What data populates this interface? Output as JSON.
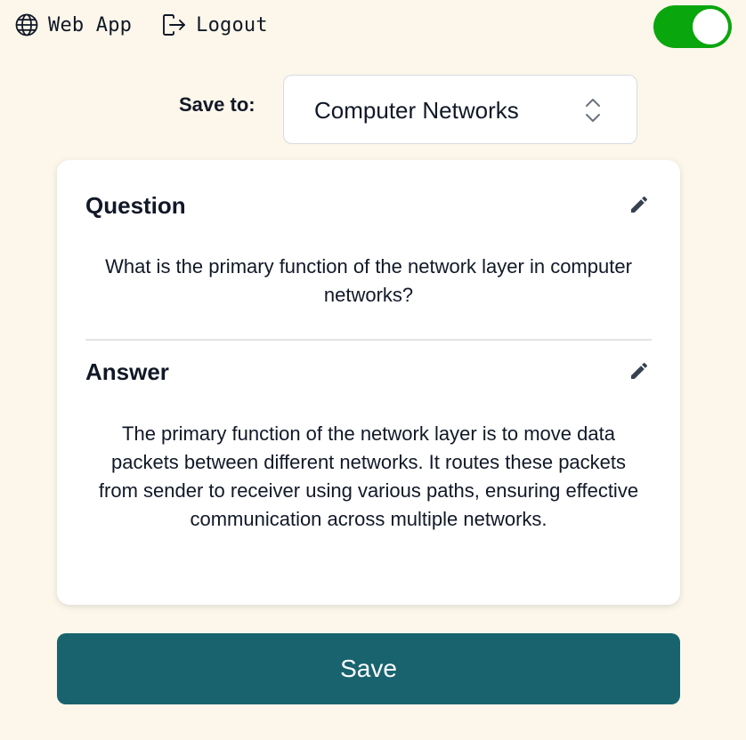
{
  "topbar": {
    "web_app_label": "Web App",
    "logout_label": "Logout",
    "web_app_icon": "globe-icon",
    "logout_icon": "logout-icon"
  },
  "toggle": {
    "state": "on",
    "color": "#0aa60e"
  },
  "save_to": {
    "label": "Save to:",
    "selected": "Computer Networks"
  },
  "card": {
    "question": {
      "title": "Question",
      "text": "What is the primary function of the network layer in computer networks?"
    },
    "answer": {
      "title": "Answer",
      "text": "The primary function of the network layer is to move data packets between different networks. It routes these packets from sender to receiver using various paths, ensuring effective communication across multiple networks."
    }
  },
  "save_button": {
    "label": "Save",
    "color": "#19636f"
  }
}
